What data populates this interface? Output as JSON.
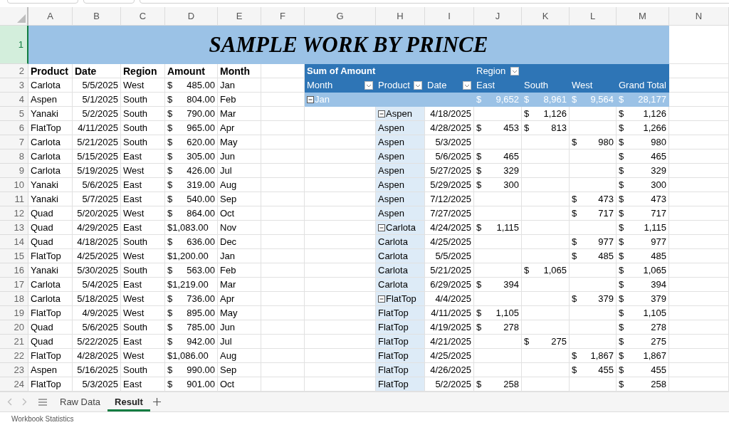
{
  "column_headers": [
    "A",
    "B",
    "C",
    "D",
    "E",
    "F",
    "G",
    "H",
    "I",
    "J",
    "K",
    "L",
    "M",
    "N"
  ],
  "row_headers": [
    {
      "label": "1",
      "selected": true
    },
    {
      "label": "2",
      "selected": false
    },
    {
      "label": "3",
      "selected": false
    },
    {
      "label": "4",
      "selected": false
    },
    {
      "label": "5",
      "selected": false
    },
    {
      "label": "6",
      "selected": false
    },
    {
      "label": "7",
      "selected": false
    },
    {
      "label": "8",
      "selected": false
    },
    {
      "label": "9",
      "selected": false
    },
    {
      "label": "10",
      "selected": false
    },
    {
      "label": "11",
      "selected": false
    },
    {
      "label": "12",
      "selected": false
    },
    {
      "label": "13",
      "selected": false
    },
    {
      "label": "14",
      "selected": false
    },
    {
      "label": "15",
      "selected": false
    },
    {
      "label": "16",
      "selected": false
    },
    {
      "label": "17",
      "selected": false
    },
    {
      "label": "18",
      "selected": false
    },
    {
      "label": "19",
      "selected": false
    },
    {
      "label": "20",
      "selected": false
    },
    {
      "label": "21",
      "selected": false
    },
    {
      "label": "22",
      "selected": false
    },
    {
      "label": "23",
      "selected": false
    },
    {
      "label": "24",
      "selected": false
    }
  ],
  "title": "SAMPLE WORK BY PRINCE",
  "raw_table": {
    "columns": [
      "Product",
      "Date",
      "Region",
      "Amount",
      "Month"
    ],
    "rows": [
      [
        "Carlota",
        "5/5/2025",
        "West",
        "$ 485.00",
        "Jan"
      ],
      [
        "Aspen",
        "5/1/2025",
        "South",
        "$ 804.00",
        "Feb"
      ],
      [
        "Yanaki",
        "5/2/2025",
        "South",
        "$ 790.00",
        "Mar"
      ],
      [
        "FlatTop",
        "4/11/2025",
        "South",
        "$ 965.00",
        "Apr"
      ],
      [
        "Carlota",
        "5/21/2025",
        "South",
        "$ 620.00",
        "May"
      ],
      [
        "Carlota",
        "5/15/2025",
        "East",
        "$ 305.00",
        "Jun"
      ],
      [
        "Carlota",
        "5/19/2025",
        "West",
        "$ 426.00",
        "Jul"
      ],
      [
        "Yanaki",
        "5/6/2025",
        "East",
        "$ 319.00",
        "Aug"
      ],
      [
        "Yanaki",
        "5/7/2025",
        "East",
        "$ 540.00",
        "Sep"
      ],
      [
        "Quad",
        "5/20/2025",
        "West",
        "$ 864.00",
        "Oct"
      ],
      [
        "Quad",
        "4/29/2025",
        "East",
        "$1,083.00",
        "Nov"
      ],
      [
        "Quad",
        "4/18/2025",
        "South",
        "$ 636.00",
        "Dec"
      ],
      [
        "FlatTop",
        "4/25/2025",
        "West",
        "$1,200.00",
        "Jan"
      ],
      [
        "Yanaki",
        "5/30/2025",
        "South",
        "$ 563.00",
        "Feb"
      ],
      [
        "Carlota",
        "5/4/2025",
        "East",
        "$1,219.00",
        "Mar"
      ],
      [
        "Carlota",
        "5/18/2025",
        "West",
        "$ 736.00",
        "Apr"
      ],
      [
        "FlatTop",
        "4/9/2025",
        "West",
        "$ 895.00",
        "May"
      ],
      [
        "Quad",
        "5/6/2025",
        "South",
        "$ 785.00",
        "Jun"
      ],
      [
        "Quad",
        "5/22/2025",
        "East",
        "$ 942.00",
        "Jul"
      ],
      [
        "FlatTop",
        "4/28/2025",
        "West",
        "$1,086.00",
        "Aug"
      ],
      [
        "Aspen",
        "5/16/2025",
        "South",
        "$ 990.00",
        "Sep"
      ],
      [
        "FlatTop",
        "5/3/2025",
        "East",
        "$ 901.00",
        "Oct"
      ]
    ]
  },
  "pivot": {
    "value_label": "Sum of Amount",
    "column_field": "Region",
    "row_fields": [
      "Month",
      "Product",
      "Date"
    ],
    "column_items": [
      "East",
      "South",
      "West",
      "Grand Total"
    ],
    "month": {
      "label": "Jan",
      "expanded": true,
      "values": {
        "east": "$ 9,652",
        "south": "$ 8,961",
        "west": "$ 9,564",
        "grand_total": "$ 28,177"
      }
    },
    "rows": [
      {
        "kind": "group",
        "expanded": true,
        "product": "Aspen",
        "date": "4/18/2025",
        "values": {
          "south": "$ 1,126",
          "grand_total": "$ 1,126"
        }
      },
      {
        "kind": "item",
        "product": "Aspen",
        "date": "4/28/2025",
        "values": {
          "east": "$ 453",
          "south": "$ 813",
          "grand_total": "$ 1,266"
        }
      },
      {
        "kind": "item",
        "product": "Aspen",
        "date": "5/3/2025",
        "values": {
          "west": "$ 980",
          "grand_total": "$ 980"
        }
      },
      {
        "kind": "item",
        "product": "Aspen",
        "date": "5/6/2025",
        "values": {
          "east": "$ 465",
          "grand_total": "$ 465"
        }
      },
      {
        "kind": "item",
        "product": "Aspen",
        "date": "5/27/2025",
        "values": {
          "east": "$ 329",
          "grand_total": "$ 329"
        }
      },
      {
        "kind": "item",
        "product": "Aspen",
        "date": "5/29/2025",
        "values": {
          "east": "$ 300",
          "grand_total": "$ 300"
        }
      },
      {
        "kind": "item",
        "product": "Aspen",
        "date": "7/12/2025",
        "values": {
          "west": "$ 473",
          "grand_total": "$ 473"
        }
      },
      {
        "kind": "item",
        "product": "Aspen",
        "date": "7/27/2025",
        "values": {
          "west": "$ 717",
          "grand_total": "$ 717"
        }
      },
      {
        "kind": "group",
        "expanded": true,
        "product": "Carlota",
        "date": "4/24/2025",
        "values": {
          "east": "$ 1,115",
          "grand_total": "$ 1,115"
        }
      },
      {
        "kind": "item",
        "product": "Carlota",
        "date": "4/25/2025",
        "values": {
          "west": "$ 977",
          "grand_total": "$ 977"
        }
      },
      {
        "kind": "item",
        "product": "Carlota",
        "date": "5/5/2025",
        "values": {
          "west": "$ 485",
          "grand_total": "$ 485"
        }
      },
      {
        "kind": "item",
        "product": "Carlota",
        "date": "5/21/2025",
        "values": {
          "south": "$ 1,065",
          "grand_total": "$ 1,065"
        }
      },
      {
        "kind": "item",
        "product": "Carlota",
        "date": "6/29/2025",
        "values": {
          "east": "$ 394",
          "grand_total": "$ 394"
        }
      },
      {
        "kind": "group",
        "expanded": true,
        "product": "FlatTop",
        "date": "4/4/2025",
        "values": {
          "west": "$ 379",
          "grand_total": "$ 379"
        }
      },
      {
        "kind": "item",
        "product": "FlatTop",
        "date": "4/11/2025",
        "values": {
          "east": "$ 1,105",
          "grand_total": "$ 1,105"
        }
      },
      {
        "kind": "item",
        "product": "FlatTop",
        "date": "4/19/2025",
        "values": {
          "east": "$ 278",
          "grand_total": "$ 278"
        }
      },
      {
        "kind": "item",
        "product": "FlatTop",
        "date": "4/21/2025",
        "values": {
          "south": "$ 275",
          "grand_total": "$ 275"
        }
      },
      {
        "kind": "item",
        "product": "FlatTop",
        "date": "4/25/2025",
        "values": {
          "west": "$ 1,867",
          "grand_total": "$ 1,867"
        }
      },
      {
        "kind": "item",
        "product": "FlatTop",
        "date": "4/26/2025",
        "values": {
          "west": "$ 455",
          "grand_total": "$ 455"
        }
      },
      {
        "kind": "item",
        "product": "FlatTop",
        "date": "5/2/2025",
        "values": {
          "east": "$ 258",
          "grand_total": "$ 258"
        }
      }
    ]
  },
  "sheet_tabs": [
    {
      "label": "Raw Data",
      "selected": false
    },
    {
      "label": "Result",
      "selected": true
    }
  ],
  "status_bar": "Workbook Statistics"
}
